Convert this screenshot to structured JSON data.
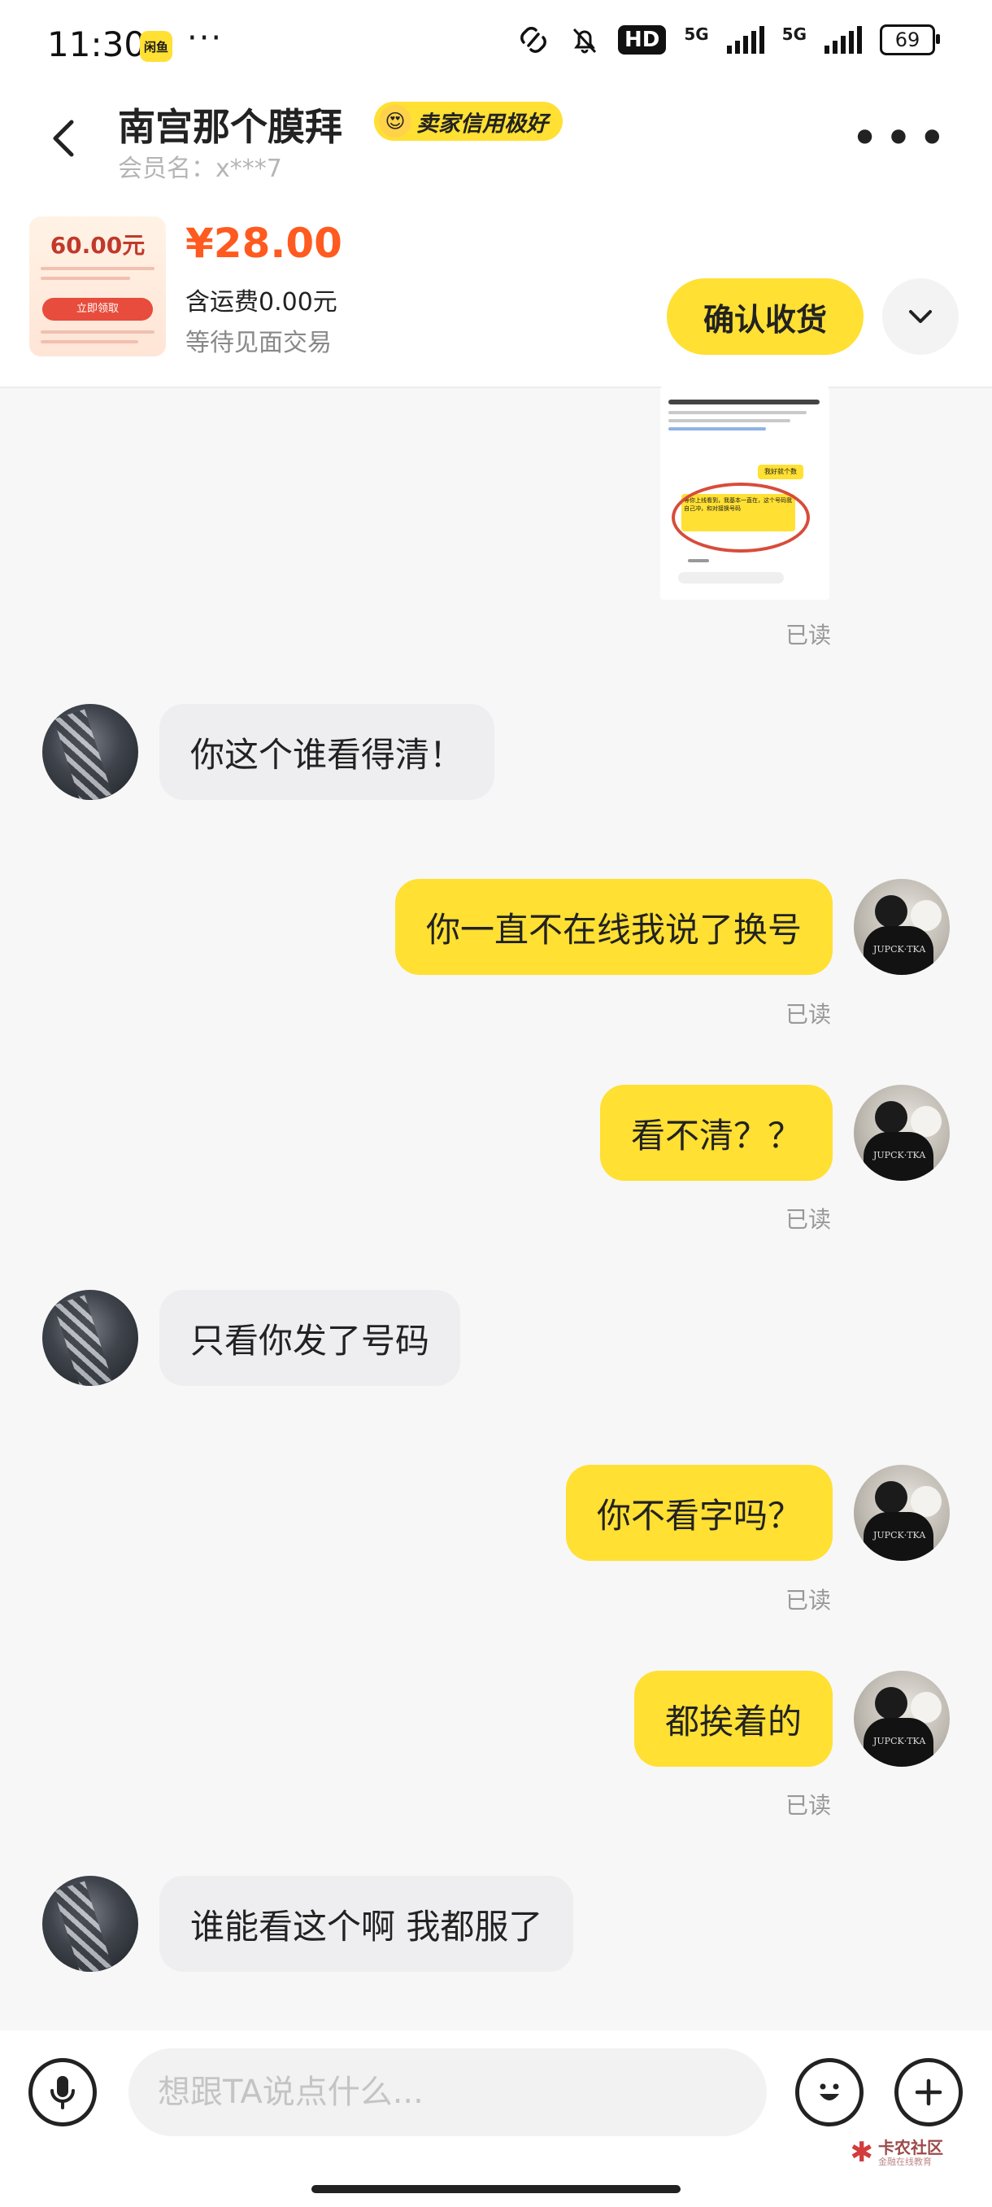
{
  "status_bar": {
    "time": "11:30",
    "app_icon_label": "闲鱼",
    "dots": "···",
    "hd_label": "HD",
    "network_1": "5G",
    "network_2": "5G",
    "battery": "69"
  },
  "header": {
    "seller_name": "南宫那个膜拜",
    "badge_label": "卖家信用极好",
    "member_label": "会员名：x***7",
    "more_icon": "more-icon"
  },
  "product": {
    "thumb_amount": "60.00元",
    "thumb_button": "立即领取",
    "price": "¥28.00",
    "shipping": "含运费0.00元",
    "status": "等待见面交易",
    "confirm_label": "确认收货"
  },
  "chat": {
    "screenshot_bubble_text": "我好就个数",
    "screenshot_red_text": "等你上线看到，我基本一直在，这个号码我自己冲，和对接换号码",
    "messages": [
      {
        "side": "in",
        "text": "你这个谁看得清！"
      },
      {
        "side": "out",
        "text": "你一直不在线我说了换号",
        "read": "已读"
      },
      {
        "side": "out",
        "text": "看不清？？",
        "read": "已读"
      },
      {
        "side": "in",
        "text": "只看你发了号码"
      },
      {
        "side": "out",
        "text": "你不看字吗？",
        "read": "已读"
      },
      {
        "side": "out",
        "text": "都挨着的",
        "read": "已读"
      },
      {
        "side": "in",
        "text": "谁能看这个啊 我都服了"
      }
    ],
    "first_read": "已读"
  },
  "input_bar": {
    "placeholder": "想跟TA说点什么...",
    "watermark_main": "卡农社区",
    "watermark_sub": "金融在线教育"
  },
  "colors": {
    "accent_yellow": "#ffe033",
    "price_orange": "#ff5a1f",
    "read_gray": "#999999"
  }
}
